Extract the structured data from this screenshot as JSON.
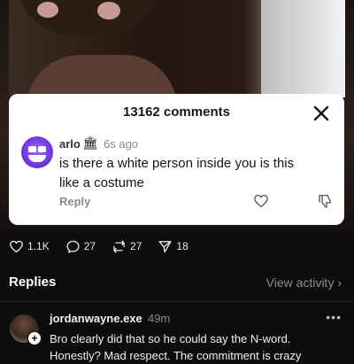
{
  "comments_panel": {
    "title": "13162 comments"
  },
  "comment": {
    "username": "arlo",
    "badge": "🏛",
    "time": "6s ago",
    "text": "is there a white person inside you is this like a costume",
    "reply_label": "Reply"
  },
  "actions": {
    "likes": "1.1K",
    "comments": "27",
    "reposts": "27",
    "shares": "18"
  },
  "replies": {
    "heading": "Replies",
    "view_activity": "View activity ›",
    "items": [
      {
        "username": "jordanwayne.exe",
        "time": "49m",
        "more": "•••",
        "text": "Bro clearly did that so he could say the N-word. Honestly? Mad respect. The commitment is crazy"
      }
    ]
  },
  "icons": {
    "follow": "+"
  },
  "colors": {
    "background": "#0d0d0d",
    "card": "#ffffff",
    "muted": "#8e8e8e"
  }
}
